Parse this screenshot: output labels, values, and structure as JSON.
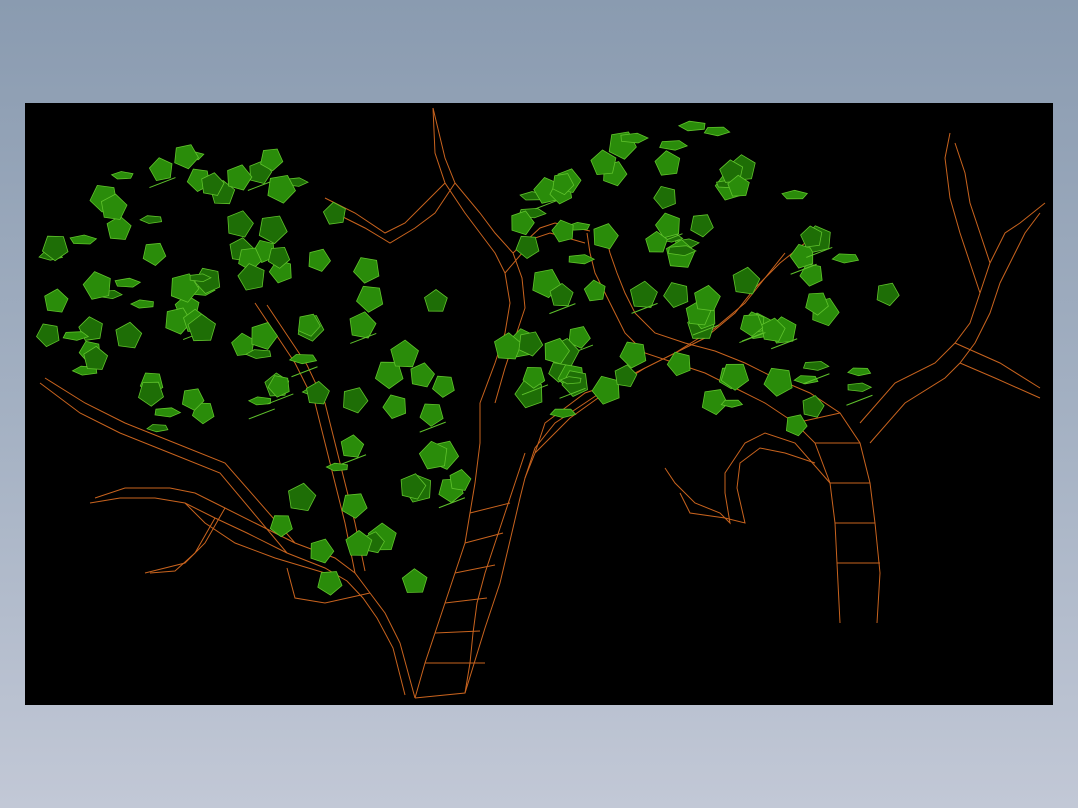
{
  "drawing": {
    "subject": "tree-wireframe",
    "canvas_background": "#000000",
    "viewport_background_top": "#8a9bb0",
    "viewport_background_bottom": "#c2c8d6",
    "trunk_color": "#c8631e",
    "leaf_fill": "#2a8c0a",
    "leaf_stroke": "#5fc22c",
    "leaf_dark_fill": "#1e6e06",
    "leaf_count_left_canopy": 95,
    "leaf_count_right_canopy": 85,
    "trees": [
      {
        "name": "left-tree"
      },
      {
        "name": "right-tree"
      }
    ]
  }
}
